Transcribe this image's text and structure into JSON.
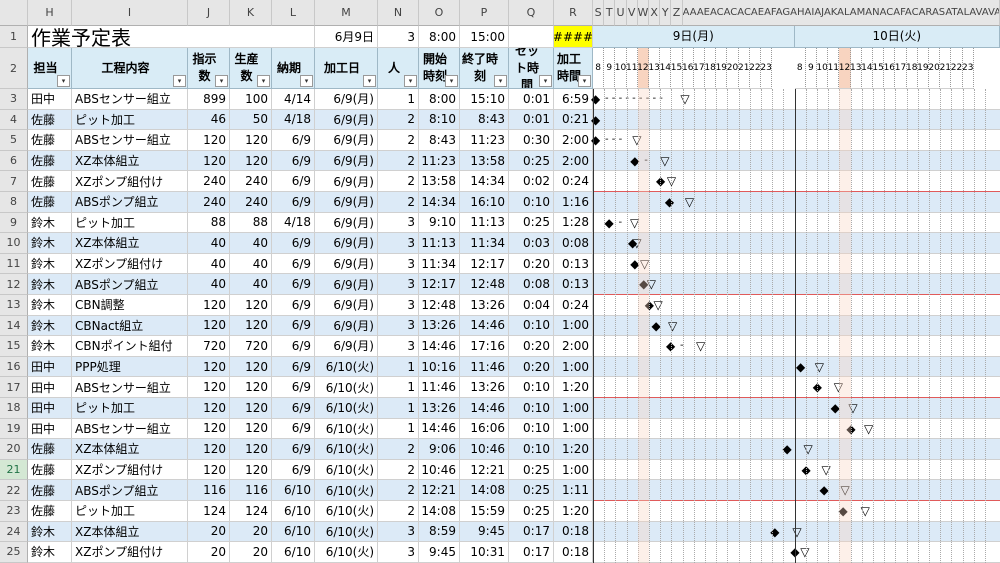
{
  "column_headers": [
    "H",
    "I",
    "J",
    "K",
    "L",
    "M",
    "N",
    "O",
    "P",
    "Q",
    "R",
    "S",
    "T",
    "U",
    "V",
    "W",
    "X",
    "Y",
    "Z",
    "AAAEACACACAEAFAGAHAIAJAKALAMANACAFACARASATALAVAVAX"
  ],
  "row_numbers": [
    "1",
    "2",
    "3",
    "4",
    "5",
    "6",
    "7",
    "8",
    "9",
    "10",
    "11",
    "12",
    "13",
    "14",
    "15",
    "16",
    "17",
    "18",
    "19",
    "20",
    "21",
    "22",
    "23",
    "24",
    "25"
  ],
  "title": "作業予定表",
  "row1": {
    "date": "6月9日",
    "n": "3",
    "start": "8:00",
    "end": "15:00",
    "overflow": "####"
  },
  "headers": {
    "worker": "担当",
    "process": "工程内容",
    "order_qty": "指示数",
    "prod_qty": "生産数",
    "due": "納期",
    "work_date": "加工日",
    "people": "人",
    "start": "開始時刻",
    "end": "終了時刻",
    "setup": "セット時間",
    "proc": "加工時間"
  },
  "gantt": {
    "day1": "9日(月)",
    "day2": "10日(火)",
    "hours": [
      "8",
      "9",
      "10",
      "11",
      "12",
      "13",
      "14",
      "15",
      "16",
      "17",
      "18",
      "19",
      "20",
      "21",
      "22",
      "23"
    ]
  },
  "rows": [
    [
      "田中",
      "ABSセンサー組立",
      "899",
      "100",
      "4/14",
      "6/9(月)",
      "1",
      "8:00",
      "15:10",
      "0:01",
      "6:59"
    ],
    [
      "佐藤",
      "ピット加工",
      "46",
      "50",
      "4/18",
      "6/9(月)",
      "2",
      "8:10",
      "8:43",
      "0:01",
      "0:21"
    ],
    [
      "佐藤",
      "ABSセンサー組立",
      "120",
      "120",
      "6/9",
      "6/9(月)",
      "2",
      "8:43",
      "11:23",
      "0:30",
      "2:00"
    ],
    [
      "佐藤",
      "XZ本体組立",
      "120",
      "120",
      "6/9",
      "6/9(月)",
      "2",
      "11:23",
      "13:58",
      "0:25",
      "2:00"
    ],
    [
      "佐藤",
      "XZポンプ組付け",
      "240",
      "240",
      "6/9",
      "6/9(月)",
      "2",
      "13:58",
      "14:34",
      "0:02",
      "0:24"
    ],
    [
      "佐藤",
      "ABSポンプ組立",
      "240",
      "240",
      "6/9",
      "6/9(月)",
      "2",
      "14:34",
      "16:10",
      "0:10",
      "1:16"
    ],
    [
      "鈴木",
      "ピット加工",
      "88",
      "88",
      "4/18",
      "6/9(月)",
      "3",
      "9:10",
      "11:13",
      "0:25",
      "1:28"
    ],
    [
      "鈴木",
      "XZ本体組立",
      "40",
      "40",
      "6/9",
      "6/9(月)",
      "3",
      "11:13",
      "11:34",
      "0:03",
      "0:08"
    ],
    [
      "鈴木",
      "XZポンプ組付け",
      "40",
      "40",
      "6/9",
      "6/9(月)",
      "3",
      "11:34",
      "12:17",
      "0:20",
      "0:13"
    ],
    [
      "鈴木",
      "ABSポンプ組立",
      "40",
      "40",
      "6/9",
      "6/9(月)",
      "3",
      "12:17",
      "12:48",
      "0:08",
      "0:13"
    ],
    [
      "鈴木",
      "CBN調整",
      "120",
      "120",
      "6/9",
      "6/9(月)",
      "3",
      "12:48",
      "13:26",
      "0:04",
      "0:24"
    ],
    [
      "鈴木",
      "CBNact組立",
      "120",
      "120",
      "6/9",
      "6/9(月)",
      "3",
      "13:26",
      "14:46",
      "0:10",
      "1:00"
    ],
    [
      "鈴木",
      "CBNポイント組付",
      "720",
      "720",
      "6/9",
      "6/9(月)",
      "3",
      "14:46",
      "17:16",
      "0:20",
      "2:00"
    ],
    [
      "田中",
      "PPP処理",
      "120",
      "120",
      "6/9",
      "6/10(火)",
      "1",
      "10:16",
      "11:46",
      "0:20",
      "1:00"
    ],
    [
      "田中",
      "ABSセンサー組立",
      "120",
      "120",
      "6/9",
      "6/10(火)",
      "1",
      "11:46",
      "13:26",
      "0:10",
      "1:20"
    ],
    [
      "田中",
      "ピット加工",
      "120",
      "120",
      "6/9",
      "6/10(火)",
      "1",
      "13:26",
      "14:46",
      "0:10",
      "1:00"
    ],
    [
      "田中",
      "ABSセンサー組立",
      "120",
      "120",
      "6/9",
      "6/10(火)",
      "1",
      "14:46",
      "16:06",
      "0:10",
      "1:00"
    ],
    [
      "佐藤",
      "XZ本体組立",
      "120",
      "120",
      "6/9",
      "6/10(火)",
      "2",
      "9:06",
      "10:46",
      "0:10",
      "1:20"
    ],
    [
      "佐藤",
      "XZポンプ組付け",
      "120",
      "120",
      "6/9",
      "6/10(火)",
      "2",
      "10:46",
      "12:21",
      "0:25",
      "1:00"
    ],
    [
      "佐藤",
      "ABSポンプ組立",
      "116",
      "116",
      "6/10",
      "6/10(火)",
      "2",
      "12:21",
      "14:08",
      "0:25",
      "1:11"
    ],
    [
      "佐藤",
      "ピット加工",
      "124",
      "124",
      "6/10",
      "6/10(火)",
      "2",
      "14:08",
      "15:59",
      "0:25",
      "1:20"
    ],
    [
      "鈴木",
      "XZ本体組立",
      "20",
      "20",
      "6/10",
      "6/10(火)",
      "3",
      "8:59",
      "9:45",
      "0:17",
      "0:18"
    ],
    [
      "鈴木",
      "XZポンプ組付け",
      "20",
      "20",
      "6/10",
      "6/10(火)",
      "3",
      "9:45",
      "10:31",
      "0:17",
      "0:18"
    ]
  ],
  "gantt_bars": [
    {
      "start": 0,
      "end": 7.8
    },
    {
      "start": 0,
      "end": 0
    },
    {
      "start": 0,
      "end": 3.5
    },
    {
      "start": 3.5,
      "end": 6
    },
    {
      "start": 5.8,
      "end": 6.6
    },
    {
      "start": 6.6,
      "end": 8.2
    },
    {
      "start": 1.2,
      "end": 3.3
    },
    {
      "start": 3.3,
      "end": 3.5
    },
    {
      "start": 3.5,
      "end": 4.2
    },
    {
      "start": 4.3,
      "end": 4.8
    },
    {
      "start": 4.8,
      "end": 5.4
    },
    {
      "start": 5.4,
      "end": 6.7
    },
    {
      "start": 6.7,
      "end": 9.2
    },
    {
      "start": 18.3,
      "end": 19.8
    },
    {
      "start": 19.8,
      "end": 21.5
    },
    {
      "start": 21.4,
      "end": 22.8
    },
    {
      "start": 22.8,
      "end": 24.2
    },
    {
      "start": 17.1,
      "end": 18.8
    },
    {
      "start": 18.8,
      "end": 20.4
    },
    {
      "start": 20.4,
      "end": 22.1
    },
    {
      "start": 22.1,
      "end": 23.9
    },
    {
      "start": 16,
      "end": 17.8
    },
    {
      "start": 17.8,
      "end": 18.5
    }
  ],
  "colors": {
    "header_blue": "#d9ecf6",
    "band_blue": "#dceaf7",
    "yellow": "#ffff00",
    "noon": "#f8d4c0"
  }
}
